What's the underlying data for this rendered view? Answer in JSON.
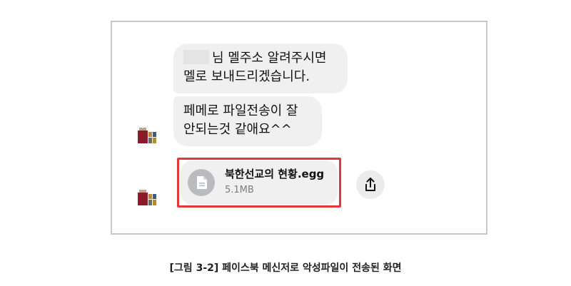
{
  "messages": [
    {
      "line1_after_redaction": "님 멜주소 알려주시면",
      "line2": "멜로 보내드리겠습니다."
    },
    {
      "line1": "페메로 파일전송이 잘",
      "line2": "안되는것 같애요^^"
    }
  ],
  "attachment": {
    "file_name": "북한선교의 현황.egg",
    "file_size": "5.1MB",
    "icon": "document-icon",
    "highlight_color": "#e0393b"
  },
  "share_icon": "share-icon",
  "caption": "[그림 3-2] 페이스북 메신저로 악성파일이 전송된 화면"
}
